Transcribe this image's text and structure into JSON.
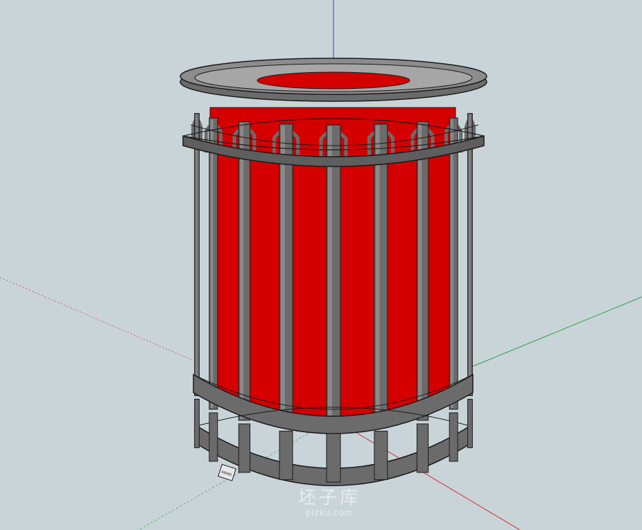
{
  "viewport": {
    "background": "#c9d4d9",
    "axes": {
      "x_color": "#d62a2a",
      "y_color": "#2ea043",
      "z_color": "#3a3af0"
    }
  },
  "model": {
    "object": "trash can",
    "liner_color": "#d40000",
    "frame_color": "#6b6b6b",
    "label_plate_text": "99999"
  },
  "watermark": {
    "main": "坯子库",
    "url": "pizku.com"
  }
}
